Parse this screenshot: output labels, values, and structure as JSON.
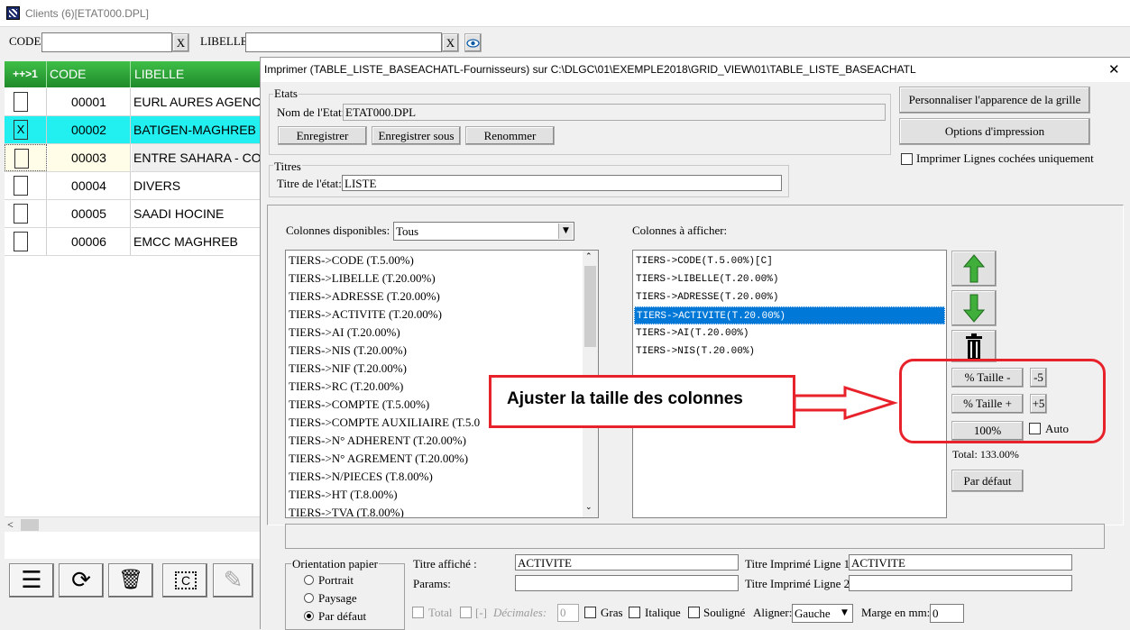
{
  "bg_window": {
    "title": "Clients (6)[ETAT000.DPL]",
    "code_label": "CODE:",
    "libelle_label": "LIBELLE:",
    "clear_x": "X",
    "grid_headers": {
      "check": "++>1",
      "code": "CODE",
      "libelle": "LIBELLE"
    },
    "rows": [
      {
        "check": "",
        "code": "00001",
        "libelle": "EURL AURES AGENCE"
      },
      {
        "check": "X",
        "code": "00002",
        "libelle": "BATIGEN-MAGHREB"
      },
      {
        "check": "",
        "code": "00003",
        "libelle": "ENTRE SAHARA - CON"
      },
      {
        "check": "",
        "code": "00004",
        "libelle": "DIVERS"
      },
      {
        "check": "",
        "code": "00005",
        "libelle": "SAADI HOCINE"
      },
      {
        "check": "",
        "code": "00006",
        "libelle": "EMCC MAGHREB"
      }
    ],
    "scroll_left": "<",
    "toolbar": {
      "menu": "☰",
      "refresh": "⟳",
      "delete": "🗑",
      "c_icon": "C",
      "edit": "✎"
    }
  },
  "dialog": {
    "title": "Imprimer (TABLE_LISTE_BASEACHATL-Fournisseurs)  sur C:\\DLGC\\01\\EXEMPLE2018\\GRID_VIEW\\01\\TABLE_LISTE_BASEACHATL",
    "close": "✕",
    "etats": {
      "legend": "Etats",
      "nom_label": "Nom de l'Etat:",
      "nom_value": "ETAT000.DPL",
      "save": "Enregistrer",
      "save_as": "Enregistrer sous",
      "rename": "Renommer"
    },
    "titres": {
      "legend": "Titres",
      "label": "Titre de l'état:",
      "value": "LISTE"
    },
    "right_buttons": {
      "customize": "Personnaliser l'apparence de la grille",
      "print_options": "Options d'impression",
      "print_checked_label": "Imprimer Lignes cochées uniquement"
    },
    "available": {
      "label": "Colonnes disponibles:",
      "filter": "Tous",
      "items": [
        "TIERS->CODE  (T.5.00%)",
        "TIERS->LIBELLE  (T.20.00%)",
        "TIERS->ADRESSE  (T.20.00%)",
        "TIERS->ACTIVITE  (T.20.00%)",
        "TIERS->AI  (T.20.00%)",
        "TIERS->NIS  (T.20.00%)",
        "TIERS->NIF  (T.20.00%)",
        "TIERS->RC  (T.20.00%)",
        "TIERS->COMPTE  (T.5.00%)",
        "TIERS->COMPTE AUXILIAIRE  (T.5.0",
        "TIERS->N° ADHERENT  (T.20.00%)",
        "TIERS->N° AGREMENT  (T.20.00%)",
        "TIERS->N/PIECES  (T.8.00%)",
        "TIERS->HT  (T.8.00%)",
        "TIERS->TVA  (T.8.00%)"
      ]
    },
    "shown": {
      "label": "Colonnes à afficher:",
      "items": [
        "TIERS->CODE(T.5.00%)[C]",
        "TIERS->LIBELLE(T.20.00%)",
        "TIERS->ADRESSE(T.20.00%)",
        "TIERS->ACTIVITE(T.20.00%)",
        "TIERS->AI(T.20.00%)",
        "TIERS->NIS(T.20.00%)"
      ],
      "selected_index": 3
    },
    "size": {
      "minus": "% Taille -",
      "minus5": "-5",
      "plus": "% Taille +",
      "plus5": "+5",
      "hundred": "100%",
      "auto": "Auto",
      "total": "Total:  133.00%",
      "default": "Par défaut"
    },
    "callout": "Ajuster la taille des colonnes",
    "orientation": {
      "legend": "Orientation papier",
      "portrait": "Portrait",
      "paysage": "Paysage",
      "defaut": "Par défaut",
      "selected": "defaut"
    },
    "props": {
      "titre_affiche_label": "Titre affiché :",
      "titre_affiche_value": "ACTIVITE",
      "params_label": "Params:",
      "params_value": "",
      "ligne1_label": "Titre Imprimé Ligne 1:",
      "ligne1_value": "ACTIVITE",
      "ligne2_label": "Titre Imprimé Ligne 2:",
      "ligne2_value": "",
      "total": "Total",
      "bracket": "[-]",
      "decimales": "Décimales:",
      "decimales_value": "0",
      "gras": "Gras",
      "italique": "Italique",
      "souligne": "Souligné",
      "aligner": "Aligner:",
      "aligner_value": "Gauche",
      "marge": "Marge en mm:",
      "marge_value": "0"
    }
  },
  "colors": {
    "accent_red": "#e8222a",
    "selected_blue": "#0078d7",
    "cyan_row": "#22f0f0",
    "grid_header_green": "#2fa33a"
  }
}
